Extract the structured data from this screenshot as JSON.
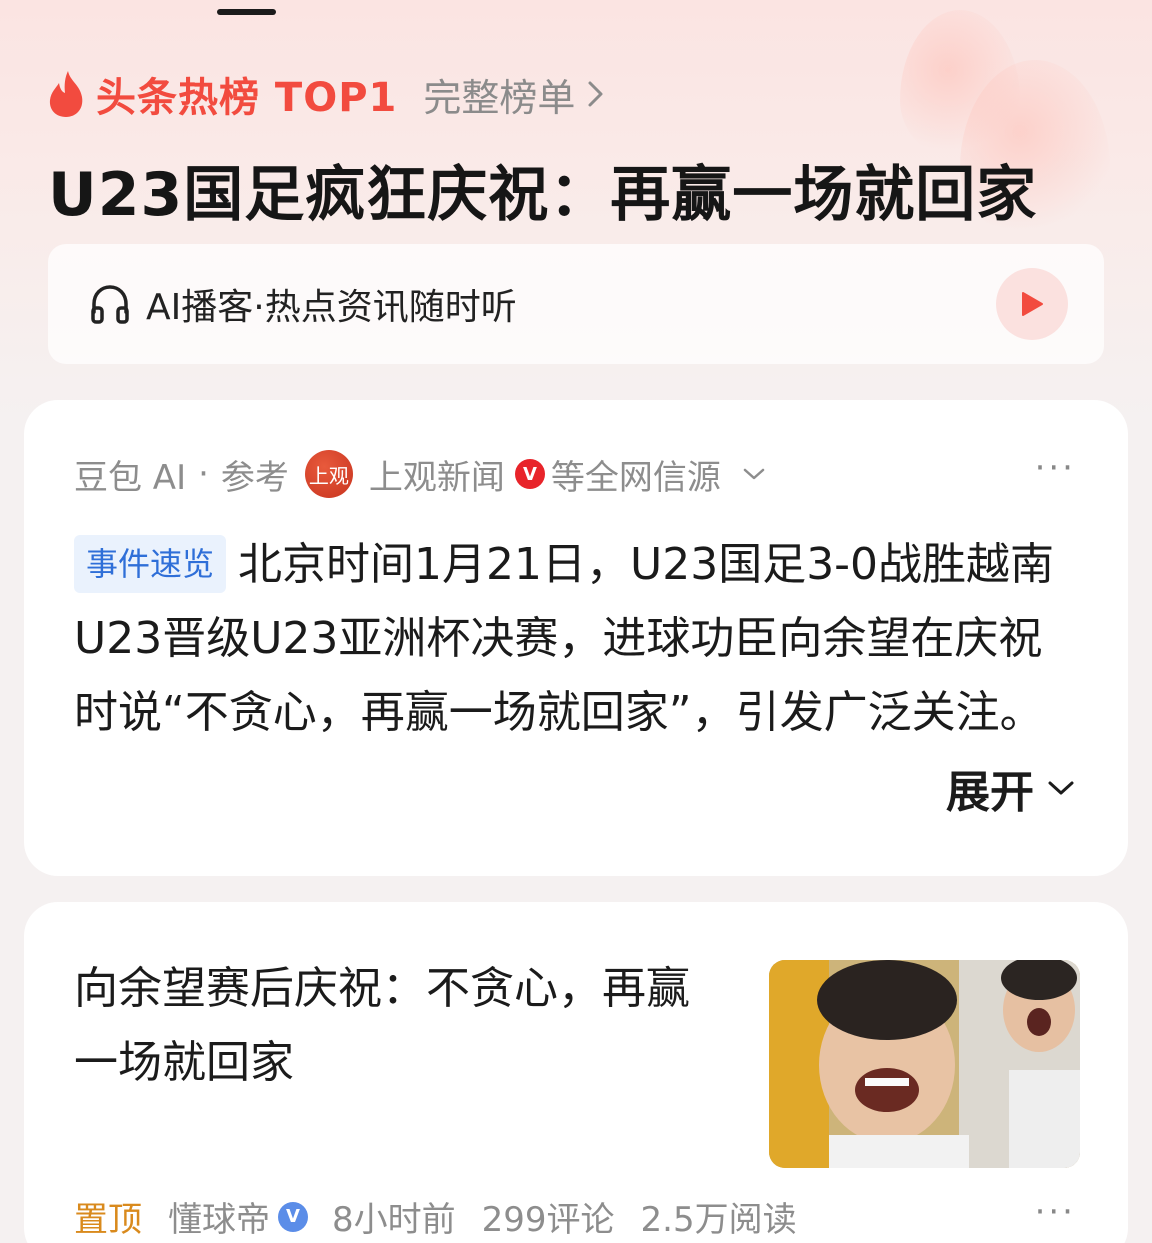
{
  "header": {
    "hot_label": "头条热榜 TOP1",
    "full_list_label": "完整榜单",
    "headline": "U23国足疯狂庆祝：再赢一场就回家"
  },
  "podcast": {
    "text": "AI播客·热点资讯随时听"
  },
  "ai_card": {
    "source_ai": "豆包 AI",
    "source_sep": "·",
    "source_ref": "参考",
    "source_logo_text": "上观",
    "source_name": "上观新闻",
    "source_suffix": "等全网信源",
    "more": "···",
    "tag": "事件速览",
    "summary": "北京时间1月21日，U23国足3-0战胜越南U23晋级U23亚洲杯决赛，进球功臣向余望在庆祝时说“不贪心，再赢一场就回家”，引发广泛关注。",
    "expand_label": "展开"
  },
  "news_card": {
    "title": "向余望赛后庆祝：不贪心，再赢一场就回家",
    "pin_label": "置顶",
    "author": "懂球帝",
    "time": "8小时前",
    "comments": "299评论",
    "reads": "2.5万阅读",
    "more": "···"
  },
  "colors": {
    "accent_red": "#f24b3f",
    "tag_blue": "#2f6fd8",
    "pin_orange": "#d98a1d"
  }
}
